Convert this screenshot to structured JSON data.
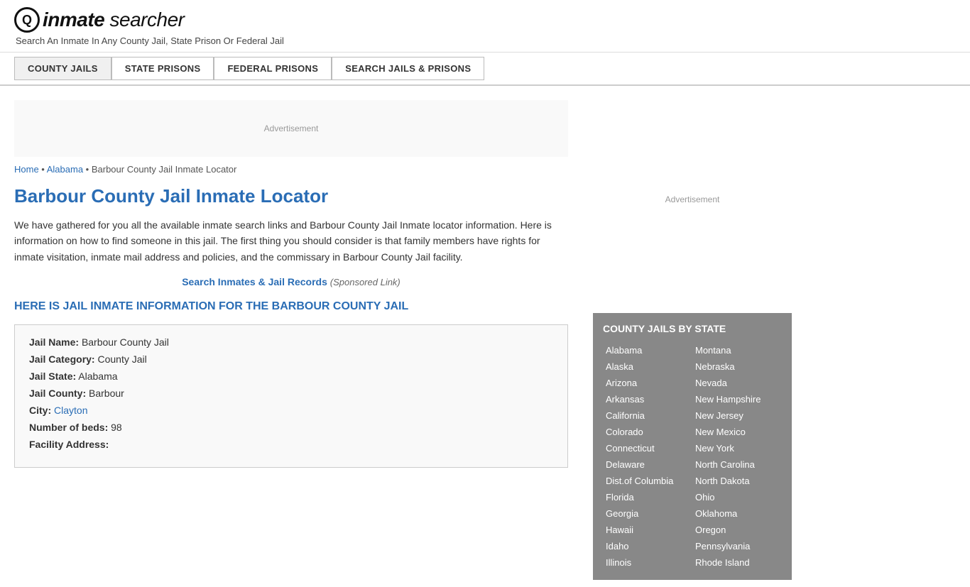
{
  "header": {
    "logo_icon": "Q",
    "logo_text": "inmate searcher",
    "tagline": "Search An Inmate In Any County Jail, State Prison Or Federal Jail"
  },
  "nav": {
    "buttons": [
      {
        "label": "COUNTY JAILS",
        "active": true
      },
      {
        "label": "STATE PRISONS",
        "active": false
      },
      {
        "label": "FEDERAL PRISONS",
        "active": false
      },
      {
        "label": "SEARCH JAILS & PRISONS",
        "active": false
      }
    ]
  },
  "ad": {
    "label": "Advertisement"
  },
  "breadcrumb": {
    "home": "Home",
    "state": "Alabama",
    "current": "Barbour County Jail Inmate Locator"
  },
  "main": {
    "title": "Barbour County Jail Inmate Locator",
    "description": "We have gathered for you all the available inmate search links and Barbour County Jail Inmate locator information. Here is information on how to find someone in this jail. The first thing you should consider is that family members have rights for inmate visitation, inmate mail address and policies, and the commissary in Barbour County Jail facility.",
    "sponsored_link_text": "Search Inmates & Jail Records",
    "sponsored_label": "(Sponsored Link)",
    "section_heading": "HERE IS JAIL INMATE INFORMATION FOR THE BARBOUR COUNTY JAIL",
    "jail_info": {
      "jail_name_label": "Jail Name:",
      "jail_name_value": "Barbour County Jail",
      "jail_category_label": "Jail Category:",
      "jail_category_value": "County Jail",
      "jail_state_label": "Jail State:",
      "jail_state_value": "Alabama",
      "jail_county_label": "Jail County:",
      "jail_county_value": "Barbour",
      "city_label": "City:",
      "city_value": "Clayton",
      "beds_label": "Number of beds:",
      "beds_value": "98",
      "address_label": "Facility Address:"
    }
  },
  "sidebar": {
    "ad_label": "Advertisement",
    "state_box_title": "COUNTY JAILS BY STATE",
    "states_left": [
      "Alabama",
      "Alaska",
      "Arizona",
      "Arkansas",
      "California",
      "Colorado",
      "Connecticut",
      "Delaware",
      "Dist.of Columbia",
      "Florida",
      "Georgia",
      "Hawaii",
      "Idaho",
      "Illinois"
    ],
    "states_right": [
      "Montana",
      "Nebraska",
      "Nevada",
      "New Hampshire",
      "New Jersey",
      "New Mexico",
      "New York",
      "North Carolina",
      "North Dakota",
      "Ohio",
      "Oklahoma",
      "Oregon",
      "Pennsylvania",
      "Rhode Island"
    ]
  }
}
